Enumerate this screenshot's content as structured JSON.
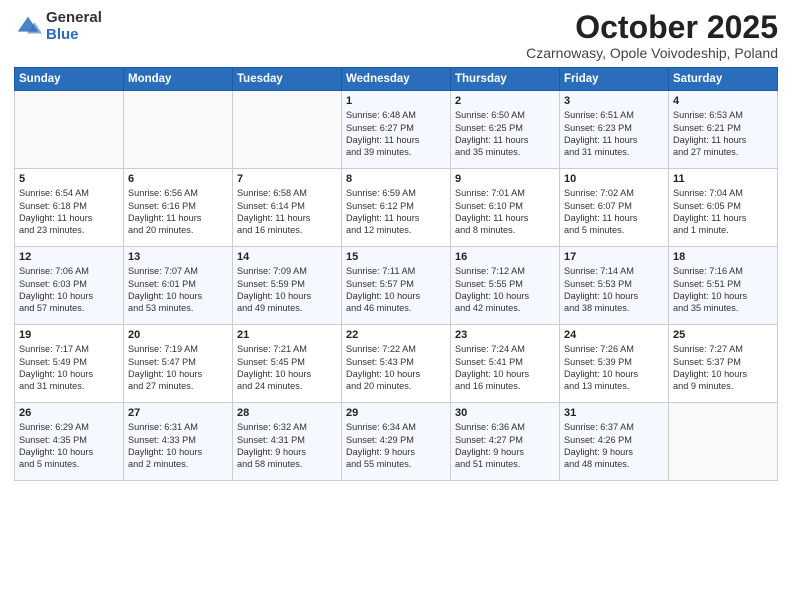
{
  "logo": {
    "general": "General",
    "blue": "Blue"
  },
  "header": {
    "month": "October 2025",
    "location": "Czarnowasy, Opole Voivodeship, Poland"
  },
  "days_of_week": [
    "Sunday",
    "Monday",
    "Tuesday",
    "Wednesday",
    "Thursday",
    "Friday",
    "Saturday"
  ],
  "weeks": [
    [
      {
        "day": "",
        "info": ""
      },
      {
        "day": "",
        "info": ""
      },
      {
        "day": "",
        "info": ""
      },
      {
        "day": "1",
        "info": "Sunrise: 6:48 AM\nSunset: 6:27 PM\nDaylight: 11 hours\nand 39 minutes."
      },
      {
        "day": "2",
        "info": "Sunrise: 6:50 AM\nSunset: 6:25 PM\nDaylight: 11 hours\nand 35 minutes."
      },
      {
        "day": "3",
        "info": "Sunrise: 6:51 AM\nSunset: 6:23 PM\nDaylight: 11 hours\nand 31 minutes."
      },
      {
        "day": "4",
        "info": "Sunrise: 6:53 AM\nSunset: 6:21 PM\nDaylight: 11 hours\nand 27 minutes."
      }
    ],
    [
      {
        "day": "5",
        "info": "Sunrise: 6:54 AM\nSunset: 6:18 PM\nDaylight: 11 hours\nand 23 minutes."
      },
      {
        "day": "6",
        "info": "Sunrise: 6:56 AM\nSunset: 6:16 PM\nDaylight: 11 hours\nand 20 minutes."
      },
      {
        "day": "7",
        "info": "Sunrise: 6:58 AM\nSunset: 6:14 PM\nDaylight: 11 hours\nand 16 minutes."
      },
      {
        "day": "8",
        "info": "Sunrise: 6:59 AM\nSunset: 6:12 PM\nDaylight: 11 hours\nand 12 minutes."
      },
      {
        "day": "9",
        "info": "Sunrise: 7:01 AM\nSunset: 6:10 PM\nDaylight: 11 hours\nand 8 minutes."
      },
      {
        "day": "10",
        "info": "Sunrise: 7:02 AM\nSunset: 6:07 PM\nDaylight: 11 hours\nand 5 minutes."
      },
      {
        "day": "11",
        "info": "Sunrise: 7:04 AM\nSunset: 6:05 PM\nDaylight: 11 hours\nand 1 minute."
      }
    ],
    [
      {
        "day": "12",
        "info": "Sunrise: 7:06 AM\nSunset: 6:03 PM\nDaylight: 10 hours\nand 57 minutes."
      },
      {
        "day": "13",
        "info": "Sunrise: 7:07 AM\nSunset: 6:01 PM\nDaylight: 10 hours\nand 53 minutes."
      },
      {
        "day": "14",
        "info": "Sunrise: 7:09 AM\nSunset: 5:59 PM\nDaylight: 10 hours\nand 49 minutes."
      },
      {
        "day": "15",
        "info": "Sunrise: 7:11 AM\nSunset: 5:57 PM\nDaylight: 10 hours\nand 46 minutes."
      },
      {
        "day": "16",
        "info": "Sunrise: 7:12 AM\nSunset: 5:55 PM\nDaylight: 10 hours\nand 42 minutes."
      },
      {
        "day": "17",
        "info": "Sunrise: 7:14 AM\nSunset: 5:53 PM\nDaylight: 10 hours\nand 38 minutes."
      },
      {
        "day": "18",
        "info": "Sunrise: 7:16 AM\nSunset: 5:51 PM\nDaylight: 10 hours\nand 35 minutes."
      }
    ],
    [
      {
        "day": "19",
        "info": "Sunrise: 7:17 AM\nSunset: 5:49 PM\nDaylight: 10 hours\nand 31 minutes."
      },
      {
        "day": "20",
        "info": "Sunrise: 7:19 AM\nSunset: 5:47 PM\nDaylight: 10 hours\nand 27 minutes."
      },
      {
        "day": "21",
        "info": "Sunrise: 7:21 AM\nSunset: 5:45 PM\nDaylight: 10 hours\nand 24 minutes."
      },
      {
        "day": "22",
        "info": "Sunrise: 7:22 AM\nSunset: 5:43 PM\nDaylight: 10 hours\nand 20 minutes."
      },
      {
        "day": "23",
        "info": "Sunrise: 7:24 AM\nSunset: 5:41 PM\nDaylight: 10 hours\nand 16 minutes."
      },
      {
        "day": "24",
        "info": "Sunrise: 7:26 AM\nSunset: 5:39 PM\nDaylight: 10 hours\nand 13 minutes."
      },
      {
        "day": "25",
        "info": "Sunrise: 7:27 AM\nSunset: 5:37 PM\nDaylight: 10 hours\nand 9 minutes."
      }
    ],
    [
      {
        "day": "26",
        "info": "Sunrise: 6:29 AM\nSunset: 4:35 PM\nDaylight: 10 hours\nand 5 minutes."
      },
      {
        "day": "27",
        "info": "Sunrise: 6:31 AM\nSunset: 4:33 PM\nDaylight: 10 hours\nand 2 minutes."
      },
      {
        "day": "28",
        "info": "Sunrise: 6:32 AM\nSunset: 4:31 PM\nDaylight: 9 hours\nand 58 minutes."
      },
      {
        "day": "29",
        "info": "Sunrise: 6:34 AM\nSunset: 4:29 PM\nDaylight: 9 hours\nand 55 minutes."
      },
      {
        "day": "30",
        "info": "Sunrise: 6:36 AM\nSunset: 4:27 PM\nDaylight: 9 hours\nand 51 minutes."
      },
      {
        "day": "31",
        "info": "Sunrise: 6:37 AM\nSunset: 4:26 PM\nDaylight: 9 hours\nand 48 minutes."
      },
      {
        "day": "",
        "info": ""
      }
    ]
  ]
}
